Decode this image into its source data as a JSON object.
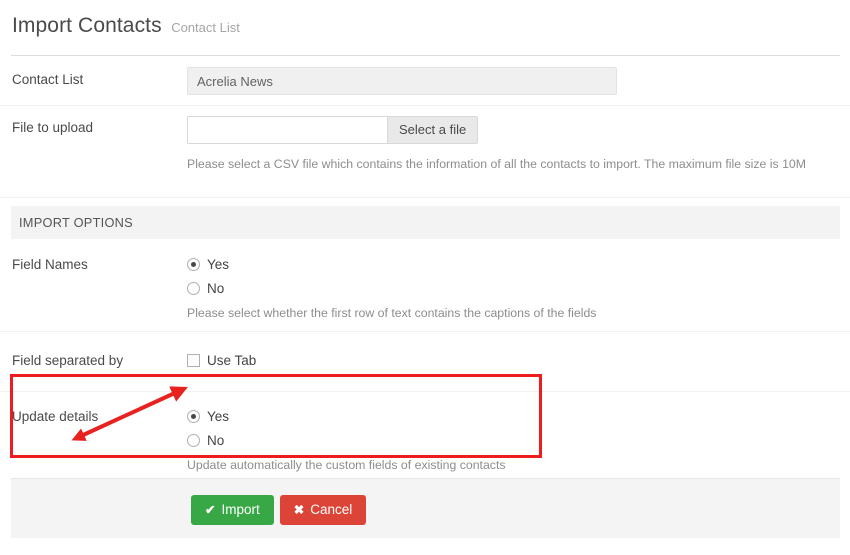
{
  "header": {
    "title": "Import Contacts",
    "subtitle": "Contact List"
  },
  "form": {
    "contact_list": {
      "label": "Contact List",
      "value": "Acrelia News"
    },
    "file_upload": {
      "label": "File to upload",
      "input_value": "",
      "input_placeholder": "",
      "button_label": "Select a file",
      "help": "Please select a CSV file which contains the information of all the contacts to import. The maximum file size is 10M"
    }
  },
  "import_options": {
    "section_title": "IMPORT OPTIONS",
    "field_names": {
      "label": "Field Names",
      "options": [
        {
          "label": "Yes",
          "selected": true
        },
        {
          "label": "No",
          "selected": false
        }
      ],
      "help": "Please select whether the first row of text contains the captions of the fields"
    },
    "field_separated_by": {
      "label": "Field separated by",
      "checkbox_label": "Use Tab",
      "checked": false
    },
    "update_details": {
      "label": "Update details",
      "options": [
        {
          "label": "Yes",
          "selected": true
        },
        {
          "label": "No",
          "selected": false
        }
      ],
      "help": "Update automatically the custom fields of existing contacts"
    }
  },
  "footer": {
    "import_label": "Import",
    "import_glyph": "✔",
    "cancel_label": "Cancel",
    "cancel_glyph": "✖"
  },
  "annotations": {
    "highlight_color": "#ee1c1c",
    "arrow_color": "#e8221f"
  }
}
